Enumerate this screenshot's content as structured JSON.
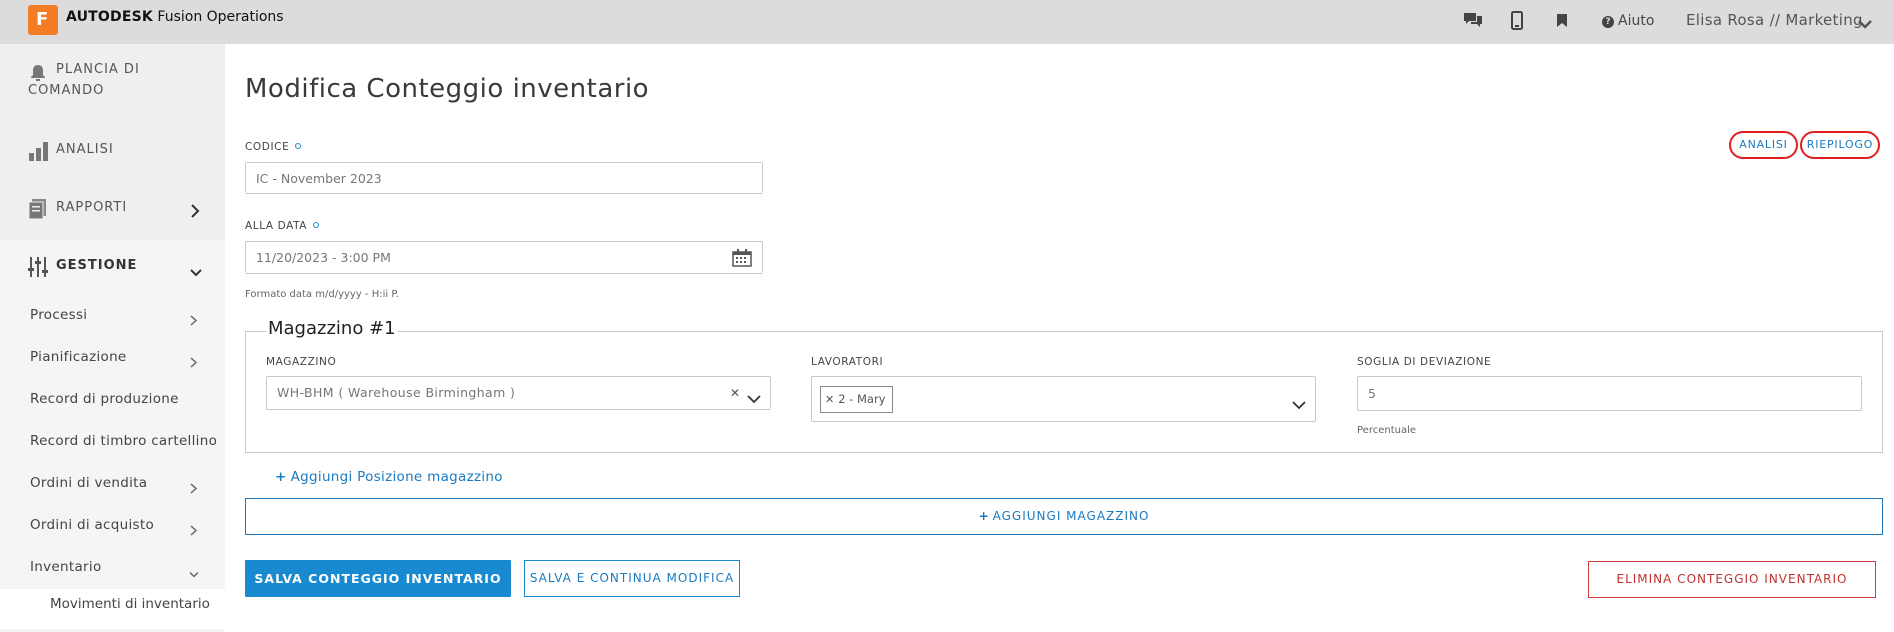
{
  "topbar": {
    "brand_bold": "AUTODESK",
    "brand_rest": " Fusion Operations",
    "logo_letter": "F",
    "help_label": "Aiuto",
    "user_label": "Elisa Rosa // Marketing"
  },
  "sidebar": {
    "top_items": [
      {
        "label_line1": "PLANCIA DI",
        "label_line2": "COMANDO",
        "icon": "bell-icon"
      },
      {
        "label": "ANALISI",
        "icon": "bar-chart-icon"
      },
      {
        "label": "RAPPORTI",
        "icon": "report-icon"
      },
      {
        "label": "GESTIONE",
        "icon": "sliders-icon"
      }
    ],
    "sub_items": [
      {
        "label": "Processi"
      },
      {
        "label": "Pianificazione"
      },
      {
        "label": "Record di produzione"
      },
      {
        "label": "Record di timbro cartellino"
      },
      {
        "label": "Ordini di vendita"
      },
      {
        "label": "Ordini di acquisto"
      },
      {
        "label": "Inventario"
      }
    ],
    "subsub_item": "Movimenti di inventario"
  },
  "main": {
    "title": "Modifica Conteggio inventario",
    "codice": {
      "label": "CODICE",
      "value": "IC - November 2023"
    },
    "alla_data": {
      "label": "ALLA DATA",
      "value": "11/20/2023 - 3:00 PM",
      "hint": "Formato data m/d/yyyy - H:ii P."
    },
    "pills": {
      "analisi": "ANALISI",
      "riepilogo": "RIEPILOGO"
    },
    "warehouse": {
      "legend": "Magazzino #1",
      "magazzino_label": "MAGAZZINO",
      "magazzino_value": "WH-BHM ( Warehouse Birmingham )",
      "lavoratori_label": "LAVORATORI",
      "lavoratori_tag": "2 - Mary",
      "soglia_label": "SOGLIA DI DEVIAZIONE",
      "soglia_value": "5",
      "soglia_hint": "Percentuale"
    },
    "add_location_link": "Aggiungi Posizione magazzino",
    "add_warehouse_button": "AGGIUNGI MAGAZZINO",
    "save_button": "SALVA CONTEGGIO INVENTARIO",
    "save_continue_button": "SALVA E CONTINUA MODIFICA",
    "delete_button": "ELIMINA CONTEGGIO INVENTARIO"
  }
}
